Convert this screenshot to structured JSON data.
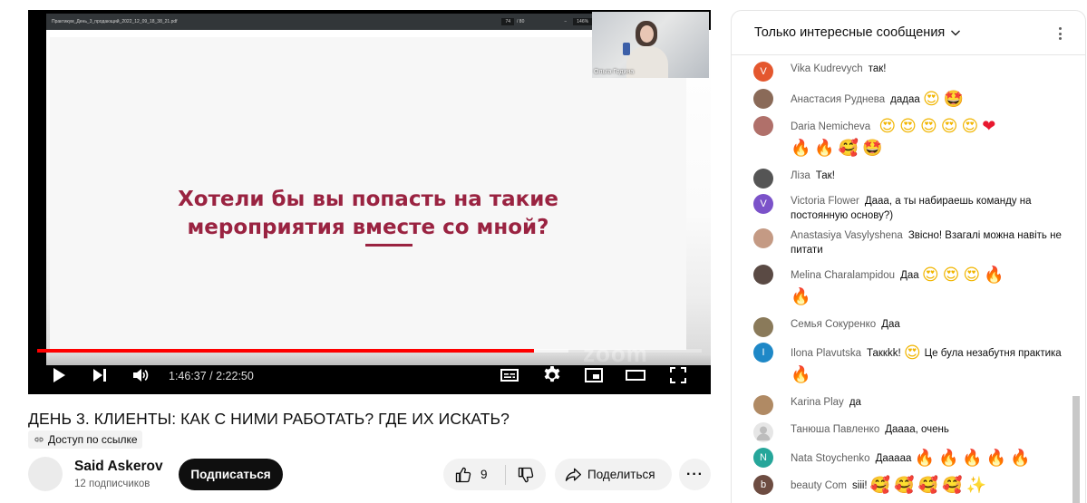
{
  "player": {
    "pdf_filename": "Практикум_День_3_продающий_2022_12_09_18_38_21.pdf",
    "pdf_page": "74",
    "pdf_page_total": "/ 80",
    "pdf_zoom": "146%",
    "slide_text_line1": "Хотели бы вы попасть на такие",
    "slide_text_line2": "мероприятия вместе со мной?",
    "webcam_name": "Ольга Година",
    "watermark": "zoom",
    "time_display": "1:46:37 / 2:22:50",
    "progress": 0.747,
    "buffered": 0.8
  },
  "video": {
    "title": "ДЕНЬ 3. КЛИЕНТЫ: КАК С НИМИ РАБОТАТЬ? ГДЕ ИХ ИСКАТЬ?",
    "access_label": "Доступ по ссылке"
  },
  "channel": {
    "name": "Said Askerov",
    "subscribers": "12 подписчиков",
    "subscribe_label": "Подписаться"
  },
  "actions": {
    "like_count": "9",
    "share_label": "Поделиться",
    "more_label": "···"
  },
  "chat": {
    "filter_label": "Только интересные сообщения",
    "messages": [
      {
        "author": "Vika Kudrevych",
        "text": "так!",
        "avatar_letter": "V",
        "avatar_color": "#e4572e"
      },
      {
        "author": "Анастасия Руднева",
        "text": "дадаа",
        "avatar_letter": "",
        "avatar_color": "#8a6a58"
      },
      {
        "author": "Daria Nemicheva",
        "text": "",
        "avatar_letter": "",
        "avatar_color": "#b0706a"
      },
      {
        "author": "Ліза",
        "text": "Так!",
        "avatar_letter": "",
        "avatar_color": "#555555"
      },
      {
        "author": "Victoria Flower",
        "text": "Дааа, а ты набираешь команду на постоянную основу?)",
        "avatar_letter": "V",
        "avatar_color": "#7b52c9"
      },
      {
        "author": "Anastasiya Vasylyshena",
        "text": "Звісно! Взагалі можна навіть не питати",
        "avatar_letter": "",
        "avatar_color": "#c49a84"
      },
      {
        "author": "Melina Charalampidou",
        "text": "Даа",
        "avatar_letter": "",
        "avatar_color": "#5a4a44"
      },
      {
        "author": "Семья Сокуренко",
        "text": "Даа",
        "avatar_letter": "",
        "avatar_color": "#8a7a5a"
      },
      {
        "author": "Ilona Plavutska",
        "text": "Таккkk!",
        "text2": "Це була незабутня практика",
        "avatar_letter": "I",
        "avatar_color": "#1e88c7"
      },
      {
        "author": "Karina Play",
        "text": "да",
        "avatar_letter": "",
        "avatar_color": "#b08a64"
      },
      {
        "author": "Танюша Павленко",
        "text": "Даааа, очень",
        "avatar_letter": "",
        "avatar_color": "#e6e6e6"
      },
      {
        "author": "Nata Stoychenko",
        "text": "Дааааа",
        "avatar_letter": "N",
        "avatar_color": "#26a69a"
      },
      {
        "author": "beauty Com",
        "text": "siii!",
        "avatar_letter": "b",
        "avatar_color": "#6d4c41"
      }
    ]
  },
  "colors": {
    "slide_text": "#9a2341",
    "progress_played": "#ff0000",
    "subscribe_bg": "#0f0f0f"
  }
}
